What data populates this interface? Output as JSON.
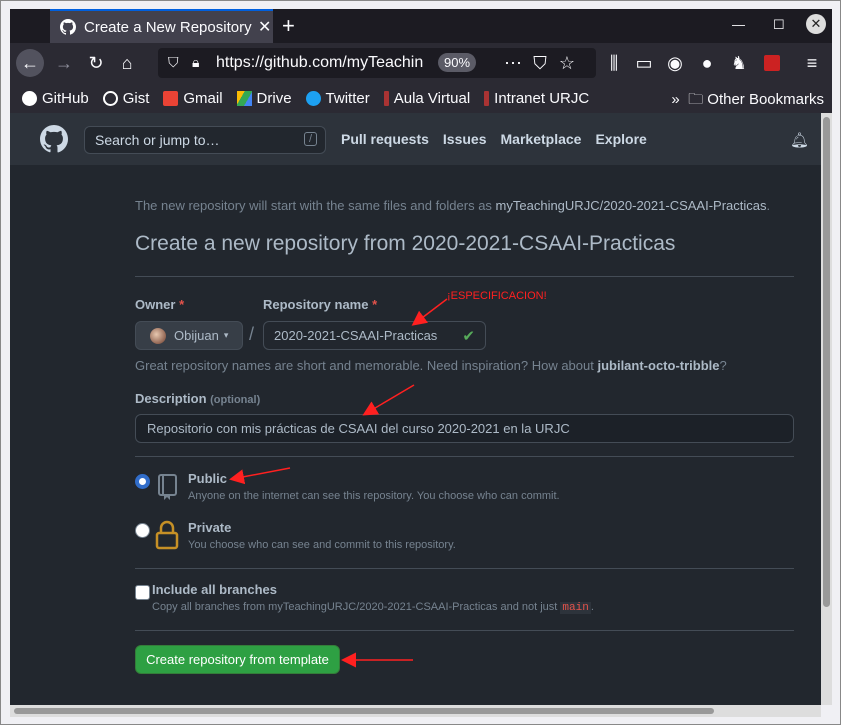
{
  "browser": {
    "tab_title": "Create a New Repository",
    "new_tab_symbol": "+",
    "url": "https://github.com/myTeachin",
    "zoom": "90%",
    "bookmarks": [
      "GitHub",
      "Gist",
      "Gmail",
      "Drive",
      "Twitter",
      "Aula Virtual",
      "Intranet URJC"
    ],
    "other_bookmarks": "Other Bookmarks"
  },
  "github": {
    "search_placeholder": "Search or jump to…",
    "search_shortcut": "/",
    "nav": [
      "Pull requests",
      "Issues",
      "Marketplace",
      "Explore"
    ]
  },
  "form": {
    "intro_prefix": "The new repository will start with the same files and folders as ",
    "intro_repo": "myTeachingURJC/2020-2021-CSAAI-Practicas",
    "intro_suffix": ".",
    "heading": "Create a new repository from 2020-2021-CSAAI-Practicas",
    "owner_label": "Owner",
    "required_mark": "*",
    "owner_value": "Obijuan",
    "repo_label": "Repository name",
    "repo_value": "2020-2021-CSAAI-Practicas",
    "hint_prefix": "Great repository names are short and memorable. Need inspiration? How about ",
    "hint_name": "jubilant-octo-tribble",
    "hint_suffix": "?",
    "description_label": "Description",
    "description_optional": "(optional)",
    "description_value": "Repositorio con mis prácticas de CSAAI del curso 2020-2021 en la URJC",
    "public_title": "Public",
    "public_desc": "Anyone on the internet can see this repository. You choose who can commit.",
    "private_title": "Private",
    "private_desc": "You choose who can see and commit to this repository.",
    "branches_title": "Include all branches",
    "branches_desc_prefix": "Copy all branches from myTeachingURJC/2020-2021-CSAAI-Practicas and not just ",
    "branches_desc_branch": "main",
    "branches_desc_suffix": ".",
    "submit_label": "Create repository from template",
    "visibility": "public",
    "include_all_branches": false
  },
  "annotation": {
    "label": "¡ESPECIFICACION!",
    "color": "#ff2020"
  },
  "colors": {
    "page_bg": "#22272e",
    "header_bg": "#2d333b",
    "button_green": "#2ea043",
    "radio_blue": "#316dca"
  }
}
